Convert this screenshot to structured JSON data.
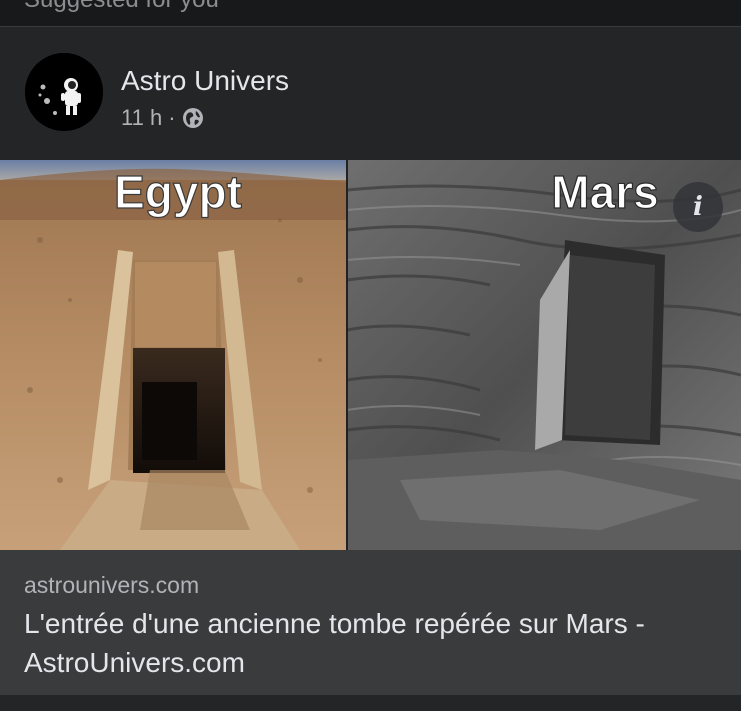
{
  "header": {
    "partial_text": "Suggested for you",
    "close_icon": "close-icon"
  },
  "post": {
    "author": "Astro Univers",
    "time": "11 h",
    "separator": "·",
    "audience_icon": "globe-icon",
    "avatar_icon": "astronaut-on-moon-logo"
  },
  "image": {
    "left_label": "Egypt",
    "right_label": "Mars",
    "info_icon": "info-icon",
    "info_glyph": "i"
  },
  "link": {
    "domain": "astrounivers.com",
    "title": "L'entrée d'une ancienne tombe repérée sur Mars - AstroUnivers.com"
  },
  "colors": {
    "background": "#18191a",
    "card": "#242526",
    "link_box": "#3a3b3c",
    "primary_text": "#e4e6eb",
    "secondary_text": "#b0b3b8"
  }
}
